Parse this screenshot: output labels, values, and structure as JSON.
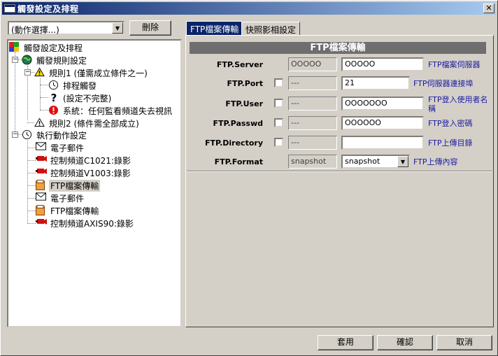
{
  "window": {
    "title": "觸發設定及排程",
    "close_glyph": "✕"
  },
  "action_combo": {
    "value": "(動作選擇...)"
  },
  "delete_button": "刪除",
  "tree": {
    "root": "觸發設定及排程",
    "rules_group": "觸發規則設定",
    "rule1": "規則1 (僅需成立條件之一)",
    "rule1_schedule": "排程觸發",
    "rule1_incomplete": "(設定不完整)",
    "rule1_system": "系統：任何監看頻道失去視訊",
    "rule2": "規則2 (條件需全部成立)",
    "actions_group": "執行動作設定",
    "actions": [
      "電子郵件",
      "控制頻道C1021:錄影",
      "控制頻道V1003:錄影",
      "FTP檔案傳輸",
      "電子郵件",
      "FTP檔案傳輸",
      "控制頻道AXIS90:錄影"
    ]
  },
  "tabs": [
    "FTP檔案傳輸",
    "快照影相設定"
  ],
  "section_title": "FTP檔案傳輸",
  "fields": [
    {
      "label": "FTP.Server",
      "checkbox": false,
      "ro": "OOOOO",
      "value": "OOOOO",
      "desc": "FTP檔案伺服器"
    },
    {
      "label": "FTP.Port",
      "checkbox": true,
      "ro": "---",
      "value": "21",
      "desc": "FTP伺服器連接埠"
    },
    {
      "label": "FTP.User",
      "checkbox": true,
      "ro": "---",
      "value": "OOOOOOO",
      "desc": "FTP登入使用者名稱"
    },
    {
      "label": "FTP.Passwd",
      "checkbox": true,
      "ro": "---",
      "value": "OOOOOO",
      "desc": "FTP登入密碼"
    },
    {
      "label": "FTP.Directory",
      "checkbox": true,
      "ro": "---",
      "value": "",
      "desc": "FTP上傳目錄"
    },
    {
      "label": "FTP.Format",
      "checkbox": false,
      "ro": "snapshot",
      "value": "snapshot",
      "desc": "FTP上傳內容"
    }
  ],
  "buttons": {
    "apply": "套用",
    "ok": "確認",
    "cancel": "取消"
  }
}
